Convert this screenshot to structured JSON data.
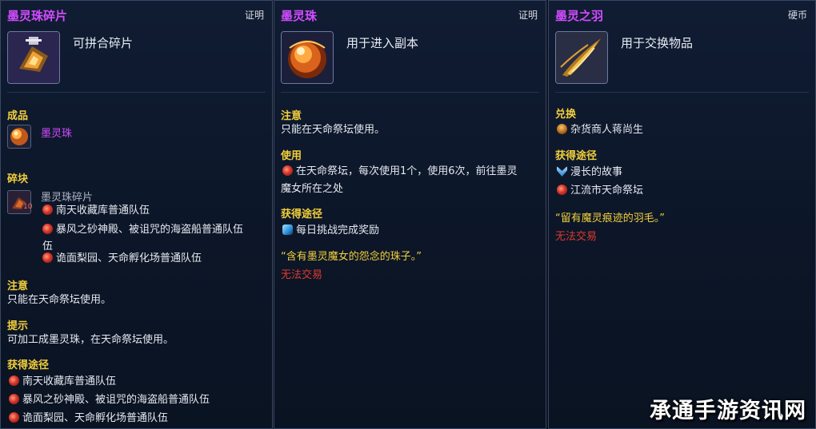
{
  "panels": [
    {
      "title": "墨灵珠碎片",
      "tag": "证明",
      "desc": "可拼合碎片",
      "product_header": "成品",
      "product_name": "墨灵珠",
      "fragment_header": "碎块",
      "fragment_name": "墨灵珠碎片",
      "fragment_count": "10",
      "fragment_sources": [
        "南天收藏库普通队伍",
        "暴风之砂神殿、被诅咒的海盗船普通队伍",
        "伍",
        "诡面梨园、天命孵化场普通队伍"
      ],
      "note_header": "注意",
      "note_text": "只能在天命祭坛使用。",
      "tip_header": "提示",
      "tip_text": "可加工成墨灵珠，在天命祭坛使用。",
      "obtain_header": "获得途径",
      "obtain_items": [
        "南天收藏库普通队伍",
        "暴风之砂神殿、被诅咒的海盗船普通队伍",
        "诡面梨园、天命孵化场普通队伍"
      ]
    },
    {
      "title": "墨灵珠",
      "tag": "证明",
      "desc": "用于进入副本",
      "note_header": "注意",
      "note_text": "只能在天命祭坛使用。",
      "use_header": "使用",
      "use_line1": "在天命祭坛，每次使用1个，使用6次，前往墨灵",
      "use_line2": "魔女所在之处",
      "obtain_header": "获得途径",
      "obtain_item": "每日挑战完成奖励",
      "quote": "“含有墨灵魔女的怨念的珠子。”",
      "restriction": "无法交易"
    },
    {
      "title": "墨灵之羽",
      "tag": "硬币",
      "desc": "用于交换物品",
      "exchange_header": "兑换",
      "exchange_item": "杂货商人蒋尚生",
      "obtain_header": "获得途径",
      "obtain_items": [
        "漫长的故事",
        "江流市天命祭坛"
      ],
      "quote": "“留有魔灵痕迹的羽毛。”",
      "restriction": "无法交易"
    }
  ],
  "watermark": "承通手游资讯网",
  "colors": {
    "title": "#d24bff",
    "header": "#f2cf3a",
    "text": "#e6e9f0",
    "restriction": "#e03a2e"
  }
}
